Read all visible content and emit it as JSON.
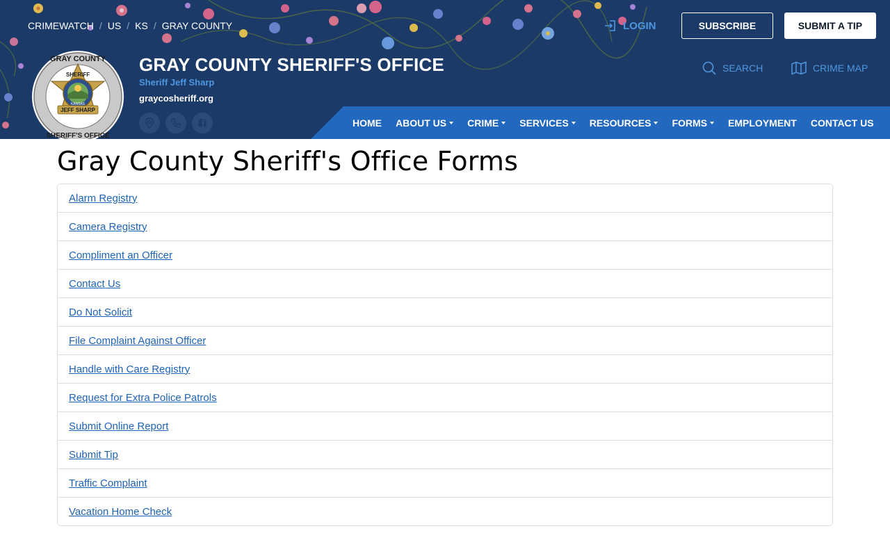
{
  "header": {
    "breadcrumb": [
      "CRIMEWATCH",
      "US",
      "KS",
      "GRAY COUNTY"
    ],
    "login_label": "LOGIN",
    "subscribe_label": "SUBSCRIBE",
    "submit_tip_label": "SUBMIT A TIP",
    "site_title": "GRAY COUNTY SHERIFF'S OFFICE",
    "sheriff_name": "Sheriff Jeff Sharp",
    "site_url": "graycosheriff.org",
    "search_label": "SEARCH",
    "crime_map_label": "CRIME MAP",
    "logo_text": {
      "top": "GRAY COUNTY",
      "badge": "SHERIFF",
      "name": "JEFF SHARP",
      "bottom": "SHERIFF'S OFFICE",
      "seal": "KANSAS"
    },
    "social_icons": [
      "map-pin-icon",
      "phone-icon",
      "facebook-icon"
    ]
  },
  "nav": {
    "items": [
      {
        "label": "HOME",
        "dropdown": false
      },
      {
        "label": "ABOUT US",
        "dropdown": true
      },
      {
        "label": "CRIME",
        "dropdown": true
      },
      {
        "label": "SERVICES",
        "dropdown": true
      },
      {
        "label": "RESOURCES",
        "dropdown": true
      },
      {
        "label": "FORMS",
        "dropdown": true
      },
      {
        "label": "EMPLOYMENT",
        "dropdown": false
      },
      {
        "label": "CONTACT US",
        "dropdown": false
      }
    ]
  },
  "main": {
    "title": "Gray County Sheriff's Office Forms",
    "forms": [
      "Alarm Registry",
      "Camera Registry",
      "Compliment an Officer",
      "Contact Us",
      "Do Not Solicit",
      "File Complaint Against Officer",
      "Handle with Care Registry",
      "Request for Extra Police Patrols",
      "Submit Online Report",
      "Submit Tip",
      "Traffic Complaint",
      "Vacation Home Check"
    ]
  },
  "colors": {
    "header_bg": "#1c3a67",
    "nav_bg": "#2168be",
    "accent": "#4e97e0",
    "link": "#1e63b5"
  }
}
